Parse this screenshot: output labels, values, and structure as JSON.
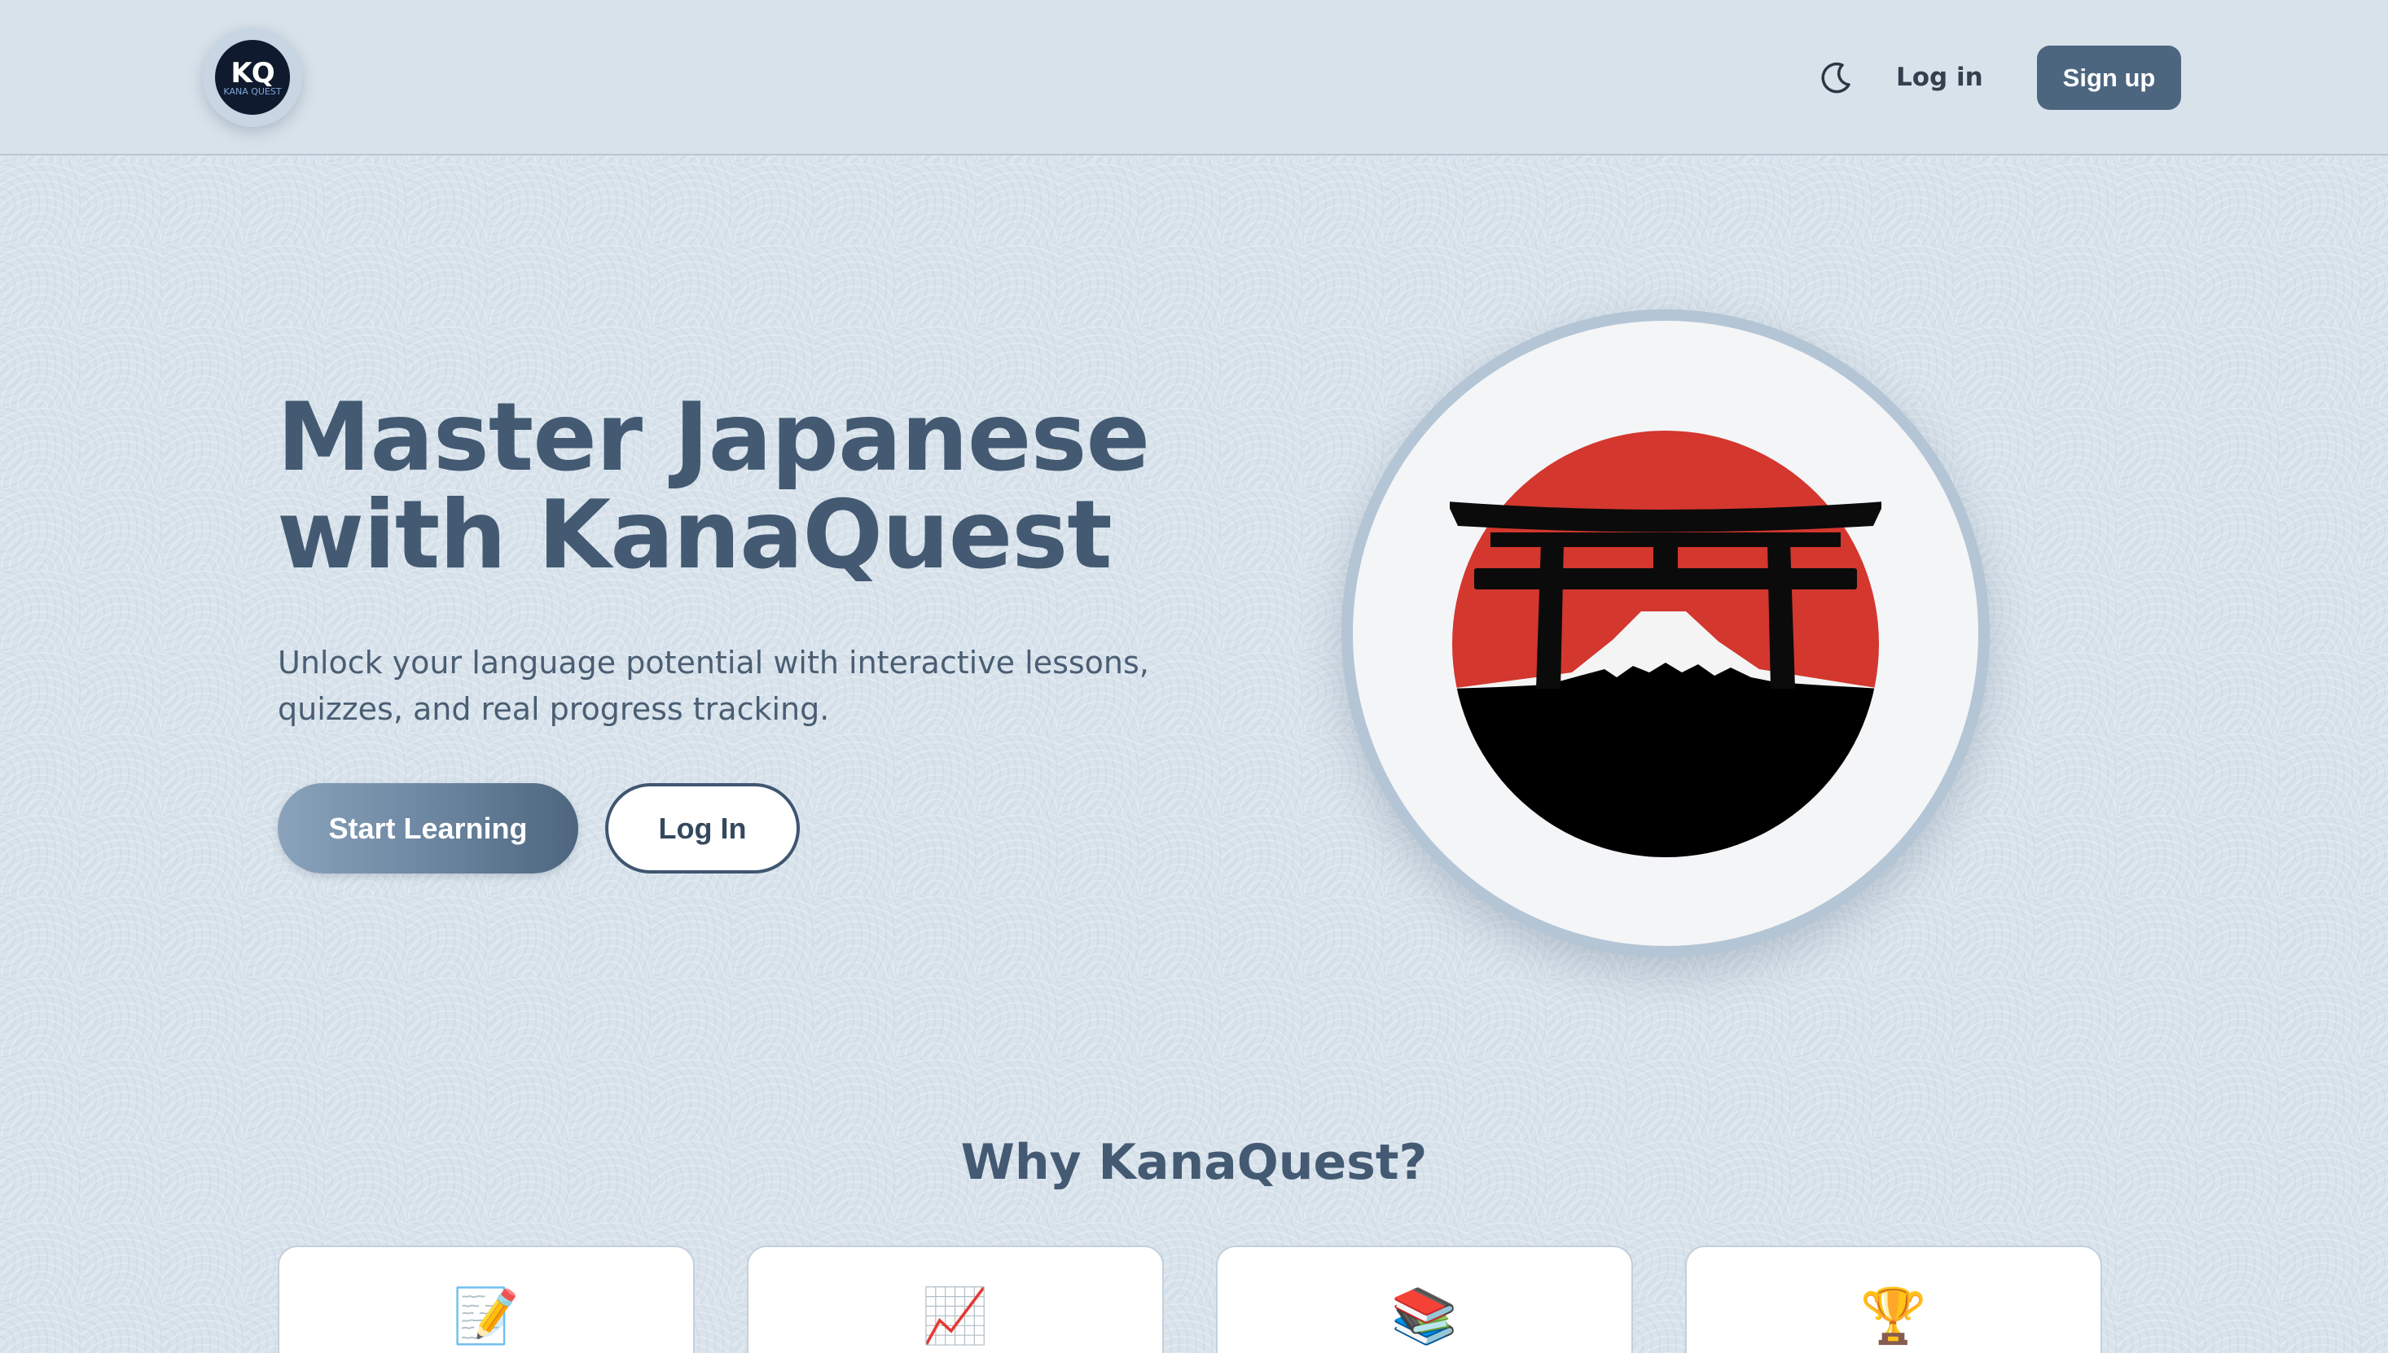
{
  "header": {
    "logo": {
      "letters": "KQ",
      "subtext": "KANA QUEST"
    },
    "theme_toggle_icon": "moon-icon",
    "login_label": "Log in",
    "signup_label": "Sign up"
  },
  "hero": {
    "title_line1": "Master Japanese",
    "title_line2": "with KanaQuest",
    "subtitle": "Unlock your language potential with interactive lessons, quizzes, and real progress tracking.",
    "start_label": "Start Learning",
    "login_label": "Log In",
    "image_icon": "torii-gate-mount-fuji-icon"
  },
  "features": {
    "title": "Why KanaQuest?",
    "cards": [
      {
        "icon": "📝",
        "icon_name": "memo-icon"
      },
      {
        "icon": "📈",
        "icon_name": "chart-increasing-icon"
      },
      {
        "icon": "📚",
        "icon_name": "books-icon"
      },
      {
        "icon": "🏆",
        "icon_name": "trophy-icon"
      }
    ]
  },
  "colors": {
    "background": "#d9e3ec",
    "primary": "#4d6680",
    "heading": "#435a72",
    "accent_red": "#d33a2f"
  }
}
